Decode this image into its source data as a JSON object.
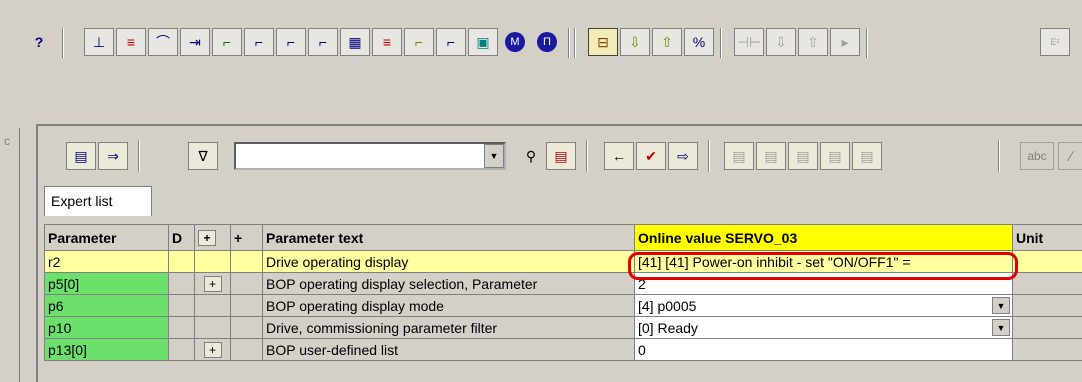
{
  "toolbar": {
    "help_icon_label": "?",
    "icons": [
      "help-icon",
      "jog-icon",
      "setpoint-icon",
      "ramp-icon",
      "speed-controller-icon",
      "current-icon",
      "torque-icon",
      "limit-icon",
      "drive-icon",
      "encoder-icon",
      "position-icon",
      "inertia-icon",
      "io-icon",
      "motor-icon",
      "terminal-icon",
      "online-icon",
      "download-icon",
      "upload-icon",
      "ram-to-rom-icon",
      "compare-icon",
      "save-icon",
      "copy-icon",
      "open-icon",
      "e2prom-icon"
    ]
  },
  "panel": {
    "tab_label": "Expert list",
    "abc_label": "abc",
    "filter_value": ""
  },
  "table": {
    "headers": {
      "parameter": "Parameter",
      "d": "D",
      "plus1": "+",
      "plus2": "+",
      "text": "Parameter text",
      "online": "Online value SERVO_03",
      "unit": "Unit"
    },
    "rows": [
      {
        "param": "r2",
        "plus": "",
        "text": "Drive operating display",
        "value": "[41] [41] Power-on inhibit - set \"ON/OFF1\" =",
        "dropdown": false
      },
      {
        "param": "p5[0]",
        "plus": "+",
        "text": "BOP operating display selection, Parameter",
        "value": "2",
        "dropdown": false
      },
      {
        "param": "p6",
        "plus": "",
        "text": "BOP operating display mode",
        "value": "[4] p0005",
        "dropdown": true
      },
      {
        "param": "p10",
        "plus": "",
        "text": "Drive, commissioning parameter filter",
        "value": "[0] Ready",
        "dropdown": true
      },
      {
        "param": "p13[0]",
        "plus": "+",
        "text": "BOP user-defined list",
        "value": "0",
        "dropdown": false
      }
    ]
  },
  "colors": {
    "highlight_row": "#ffffa0",
    "param_green": "#6be06b",
    "online_header": "#ffff00",
    "annotation_circle": "#e00000"
  }
}
